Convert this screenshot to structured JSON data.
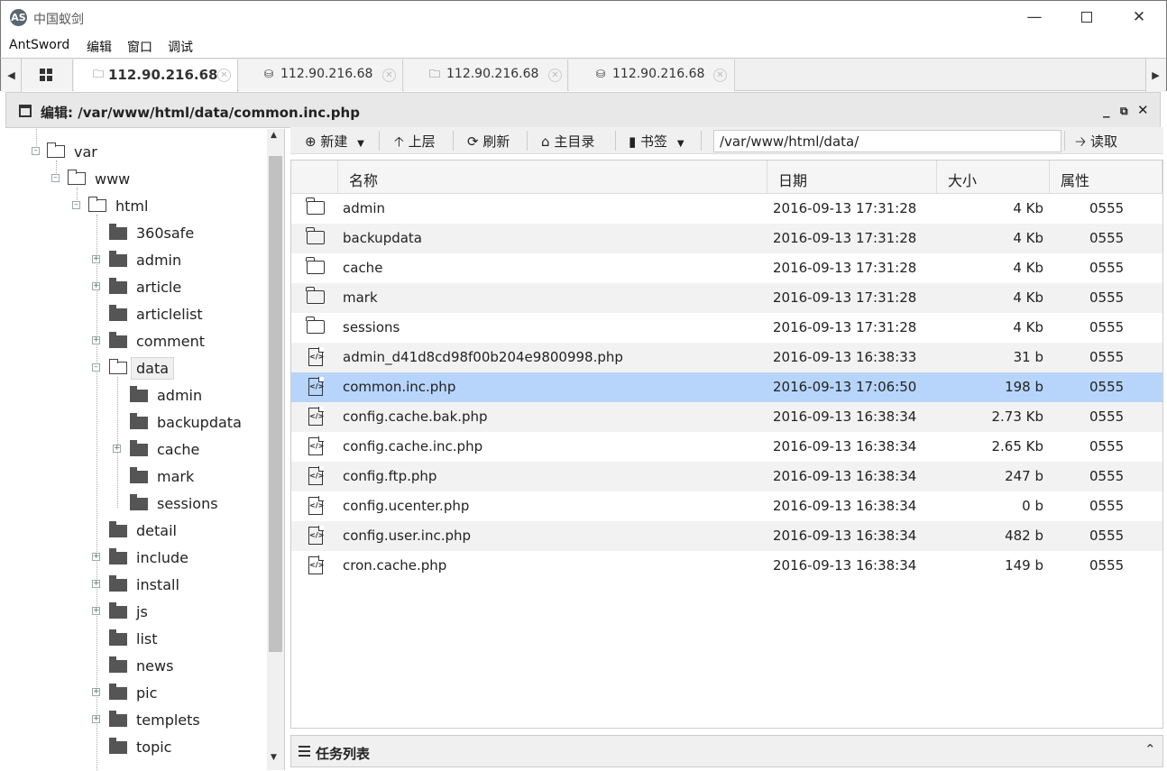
{
  "window": {
    "title": "中国蚁剑",
    "logo": "AS"
  },
  "menubar": [
    "AntSword",
    "编辑",
    "窗口",
    "调试"
  ],
  "tabs": [
    {
      "label": "112.90.216.68",
      "icon": "folder-icon",
      "active": true
    },
    {
      "label": "112.90.216.68",
      "icon": "database-icon",
      "active": false
    },
    {
      "label": "112.90.216.68",
      "icon": "folder-icon",
      "active": false
    },
    {
      "label": "112.90.216.68",
      "icon": "database-icon",
      "active": false
    }
  ],
  "panel": {
    "title": "编辑: /var/www/html/data/common.inc.php"
  },
  "tree": [
    {
      "label": "var",
      "open": true
    },
    {
      "label": "www",
      "open": true
    },
    {
      "label": "html",
      "open": true
    },
    {
      "label": "360safe"
    },
    {
      "label": "admin"
    },
    {
      "label": "article"
    },
    {
      "label": "articlelist"
    },
    {
      "label": "comment"
    },
    {
      "label": "data",
      "open": true,
      "selected": true
    },
    {
      "label": "admin"
    },
    {
      "label": "backupdata"
    },
    {
      "label": "cache"
    },
    {
      "label": "mark"
    },
    {
      "label": "sessions"
    },
    {
      "label": "detail"
    },
    {
      "label": "include"
    },
    {
      "label": "install"
    },
    {
      "label": "js"
    },
    {
      "label": "list"
    },
    {
      "label": "news"
    },
    {
      "label": "pic"
    },
    {
      "label": "templets"
    },
    {
      "label": "topic"
    }
  ],
  "toolbar": {
    "new": "新建",
    "up": "上层",
    "refresh": "刷新",
    "home": "主目录",
    "bookmark": "书签",
    "path": "/var/www/html/data/",
    "read": "读取"
  },
  "grid": {
    "headers": [
      "名称",
      "日期",
      "大小",
      "属性"
    ],
    "rows": [
      {
        "name": "admin",
        "date": "2016-09-13 17:31:28",
        "size": "4 Kb",
        "attr": "0555",
        "type": "folder"
      },
      {
        "name": "backupdata",
        "date": "2016-09-13 17:31:28",
        "size": "4 Kb",
        "attr": "0555",
        "type": "folder"
      },
      {
        "name": "cache",
        "date": "2016-09-13 17:31:28",
        "size": "4 Kb",
        "attr": "0555",
        "type": "folder"
      },
      {
        "name": "mark",
        "date": "2016-09-13 17:31:28",
        "size": "4 Kb",
        "attr": "0555",
        "type": "folder"
      },
      {
        "name": "sessions",
        "date": "2016-09-13 17:31:28",
        "size": "4 Kb",
        "attr": "0555",
        "type": "folder"
      },
      {
        "name": "admin_d41d8cd98f00b204e9800998.php",
        "date": "2016-09-13 16:38:33",
        "size": "31 b",
        "attr": "0555",
        "type": "file"
      },
      {
        "name": "common.inc.php",
        "date": "2016-09-13 17:06:50",
        "size": "198 b",
        "attr": "0555",
        "type": "file",
        "selected": true
      },
      {
        "name": "config.cache.bak.php",
        "date": "2016-09-13 16:38:34",
        "size": "2.73 Kb",
        "attr": "0555",
        "type": "file"
      },
      {
        "name": "config.cache.inc.php",
        "date": "2016-09-13 16:38:34",
        "size": "2.65 Kb",
        "attr": "0555",
        "type": "file"
      },
      {
        "name": "config.ftp.php",
        "date": "2016-09-13 16:38:34",
        "size": "247 b",
        "attr": "0555",
        "type": "file"
      },
      {
        "name": "config.ucenter.php",
        "date": "2016-09-13 16:38:34",
        "size": "0 b",
        "attr": "0555",
        "type": "file"
      },
      {
        "name": "config.user.inc.php",
        "date": "2016-09-13 16:38:34",
        "size": "482 b",
        "attr": "0555",
        "type": "file"
      },
      {
        "name": "cron.cache.php",
        "date": "2016-09-13 16:38:34",
        "size": "149 b",
        "attr": "0555",
        "type": "file"
      }
    ]
  },
  "taskbar": {
    "label": "任务列表"
  }
}
